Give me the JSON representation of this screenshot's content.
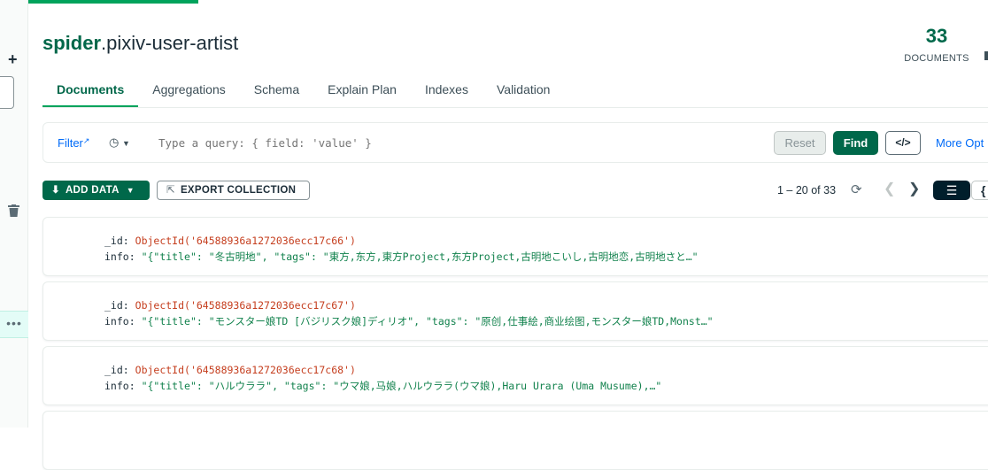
{
  "left_strip": {
    "more_label": "•••"
  },
  "header": {
    "db_name": "spider",
    "separator": ".",
    "collection_name": "pixiv-user-artist",
    "documents_count": "33",
    "documents_label": "DOCUMENTS"
  },
  "tabs": [
    {
      "label": "Documents",
      "active": true
    },
    {
      "label": "Aggregations",
      "active": false
    },
    {
      "label": "Schema",
      "active": false
    },
    {
      "label": "Explain Plan",
      "active": false
    },
    {
      "label": "Indexes",
      "active": false
    },
    {
      "label": "Validation",
      "active": false
    }
  ],
  "query_bar": {
    "filter_label": "Filter",
    "placeholder": "Type a query: { field: 'value' }",
    "reset_label": "Reset",
    "find_label": "Find",
    "code_label": "</>",
    "more_options_label": "More Opt"
  },
  "toolbar": {
    "add_data_label": "ADD DATA",
    "export_label": "EXPORT COLLECTION",
    "pagination_text": "1 – 20 of 33"
  },
  "documents": [
    {
      "id_key": "_id:",
      "id_value": "ObjectId('64588936a1272036ecc17c66')",
      "info_key": "info:",
      "info_value": "\"{\"title\": \"冬古明地\", \"tags\": \"東方,东方,東方Project,东方Project,古明地こいし,古明地恋,古明地さと…\""
    },
    {
      "id_key": "_id:",
      "id_value": "ObjectId('64588936a1272036ecc17c67')",
      "info_key": "info:",
      "info_value": "\"{\"title\": \"モンスター娘TD [バジリスク娘]ディリオ\", \"tags\": \"原创,仕事絵,商业绘图,モンスター娘TD,Monst…\""
    },
    {
      "id_key": "_id:",
      "id_value": "ObjectId('64588936a1272036ecc17c68')",
      "info_key": "info:",
      "info_value": "\"{\"title\": \"ハルウララ\", \"tags\": \"ウマ娘,马娘,ハルウララ(ウマ娘),Haru Urara (Uma Musume),…\""
    }
  ]
}
